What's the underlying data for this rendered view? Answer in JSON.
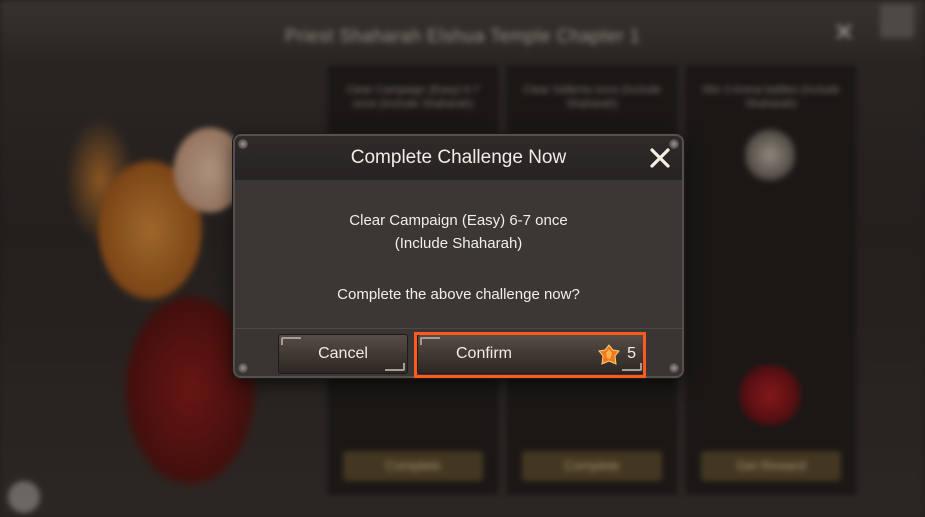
{
  "background": {
    "window_title": "Priest Shaharah Elshua Temple Chapter 1",
    "columns": [
      {
        "title": "Clear Campaign (Easy) 6-7 once (Include Shaharah)",
        "button": "Complete"
      },
      {
        "title": "Clear Sellenia once (Include Shaharah)",
        "button": "Complete"
      },
      {
        "title": "Win 3 Arena battles (Include Shaharah)",
        "button": "Get Reward"
      }
    ]
  },
  "modal": {
    "title": "Complete Challenge Now",
    "challenge_line_1": "Clear Campaign (Easy) 6-7 once",
    "challenge_line_2": "(Include Shaharah)",
    "question": "Complete the above challenge now?",
    "cancel_label": "Cancel",
    "confirm_label": "Confirm",
    "cost_value": "5",
    "cost_icon": "fire-crystal-icon",
    "close_icon": "close-icon"
  },
  "colors": {
    "highlight": "#ff5a1e",
    "modal_bg": "#3a3735",
    "text": "#f2eee8"
  }
}
